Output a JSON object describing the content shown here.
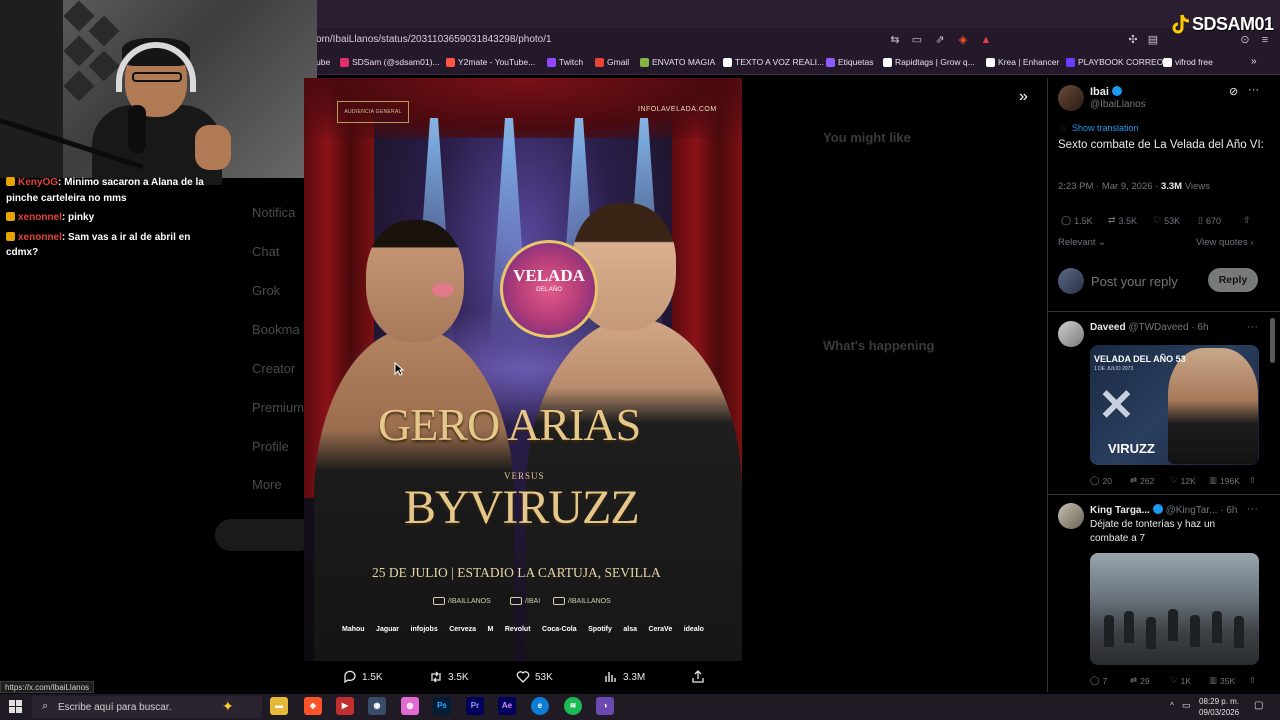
{
  "browser": {
    "url": "om/IbaiLlanos/status/2031103659031843298/photo/1",
    "bookmarks": [
      {
        "label": "ube",
        "color": "#ff0000"
      },
      {
        "label": "SDSam (@sdsam01)...",
        "color": "#e1306c"
      },
      {
        "label": "Y2mate - YouTube...",
        "color": "#ff5544"
      },
      {
        "label": "Twitch",
        "color": "#9146ff"
      },
      {
        "label": "Gmail",
        "color": "#ea4335"
      },
      {
        "label": "ENVATO MAGIA",
        "color": "#82b541"
      },
      {
        "label": "TEXTO A VOZ REALI...",
        "color": "#ffffff"
      },
      {
        "label": "Etiquetas",
        "color": "#8c5cff"
      },
      {
        "label": "Rapidtags | Grow q...",
        "color": "#ffffff"
      },
      {
        "label": "Krea | Enhancer",
        "color": "#ffffff"
      },
      {
        "label": "PLAYBOOK CORREO",
        "color": "#6a3cff"
      },
      {
        "label": "vifrod free",
        "color": "#ffffff"
      }
    ]
  },
  "watermark": {
    "label": "SDSAM01"
  },
  "chat": {
    "lines": [
      {
        "user": "KenyOG",
        "message": ": Minimo sacaron a Alana de la pinche carteleira no mms"
      },
      {
        "user": "xenonnel",
        "message": ": pinky"
      },
      {
        "user": "xenonnel",
        "message": ": Sam vas a ir al de abril en cdmx?"
      }
    ]
  },
  "poster": {
    "badge": "AUDIENCIA GENERAL",
    "site": "INFOLAVELADA.COM",
    "logo_title": "VELADA",
    "logo_sub": "DEL AÑO",
    "fighter1": "GERO ARIAS",
    "versus": "VERSUS",
    "fighter2": "BYVIRUZZ",
    "date_venue": "25 DE JULIO  |  ESTADIO LA CARTUJA, SEVILLA",
    "socials": [
      "/IBAILLANOS",
      "/IBAI",
      "/IBAILLANOS"
    ],
    "sponsors": [
      "Mahou",
      "Jaguar",
      "infojobs",
      "Cerveza",
      "M",
      "Revolut",
      "Coca-Cola",
      "Spotify",
      "alsa",
      "CeraVe",
      "idealo"
    ]
  },
  "actions": {
    "replies": "1.5K",
    "reposts": "3.5K",
    "likes": "53K",
    "views": "3.3M"
  },
  "tweet": {
    "name": "Ibai",
    "handle": "@IbaiLlanos",
    "show_translation": "Show translation",
    "text": "Sexto combate de La Velada del Año VI:",
    "time": "2:23 PM · Mar 9, 2026 · ",
    "views_count": "3.3M",
    "views_label": " Views",
    "replies": "1.5K",
    "reposts": "3.5K",
    "likes": "53K",
    "bookmarks": "670",
    "sort": "Relevant",
    "view_quotes": "View quotes",
    "reply_placeholder": "Post your reply",
    "reply_button": "Reply"
  },
  "replies": [
    {
      "name": "Daveed",
      "handle": "@TWDaveed · 6h",
      "image_title": "VELADA DEL AÑO 53",
      "image_sub": "1 DE JULIO 2073",
      "image_name": "VIRUZZ",
      "replies": "20",
      "reposts": "262",
      "likes": "12K",
      "views": "196K"
    },
    {
      "name": "King Targa...",
      "handle": "@KingTar... · 6h",
      "text": "Déjate de tonterías y haz un combate a 7",
      "replies": "7",
      "reposts": "29",
      "likes": "1K",
      "views": "35K"
    }
  ],
  "status_url": "https://x.com/IbaiLlanos",
  "taskbar": {
    "search_placeholder": "Escribe aquí para buscar.",
    "time": "08:29 p. m.",
    "date": "09/03/2026"
  }
}
